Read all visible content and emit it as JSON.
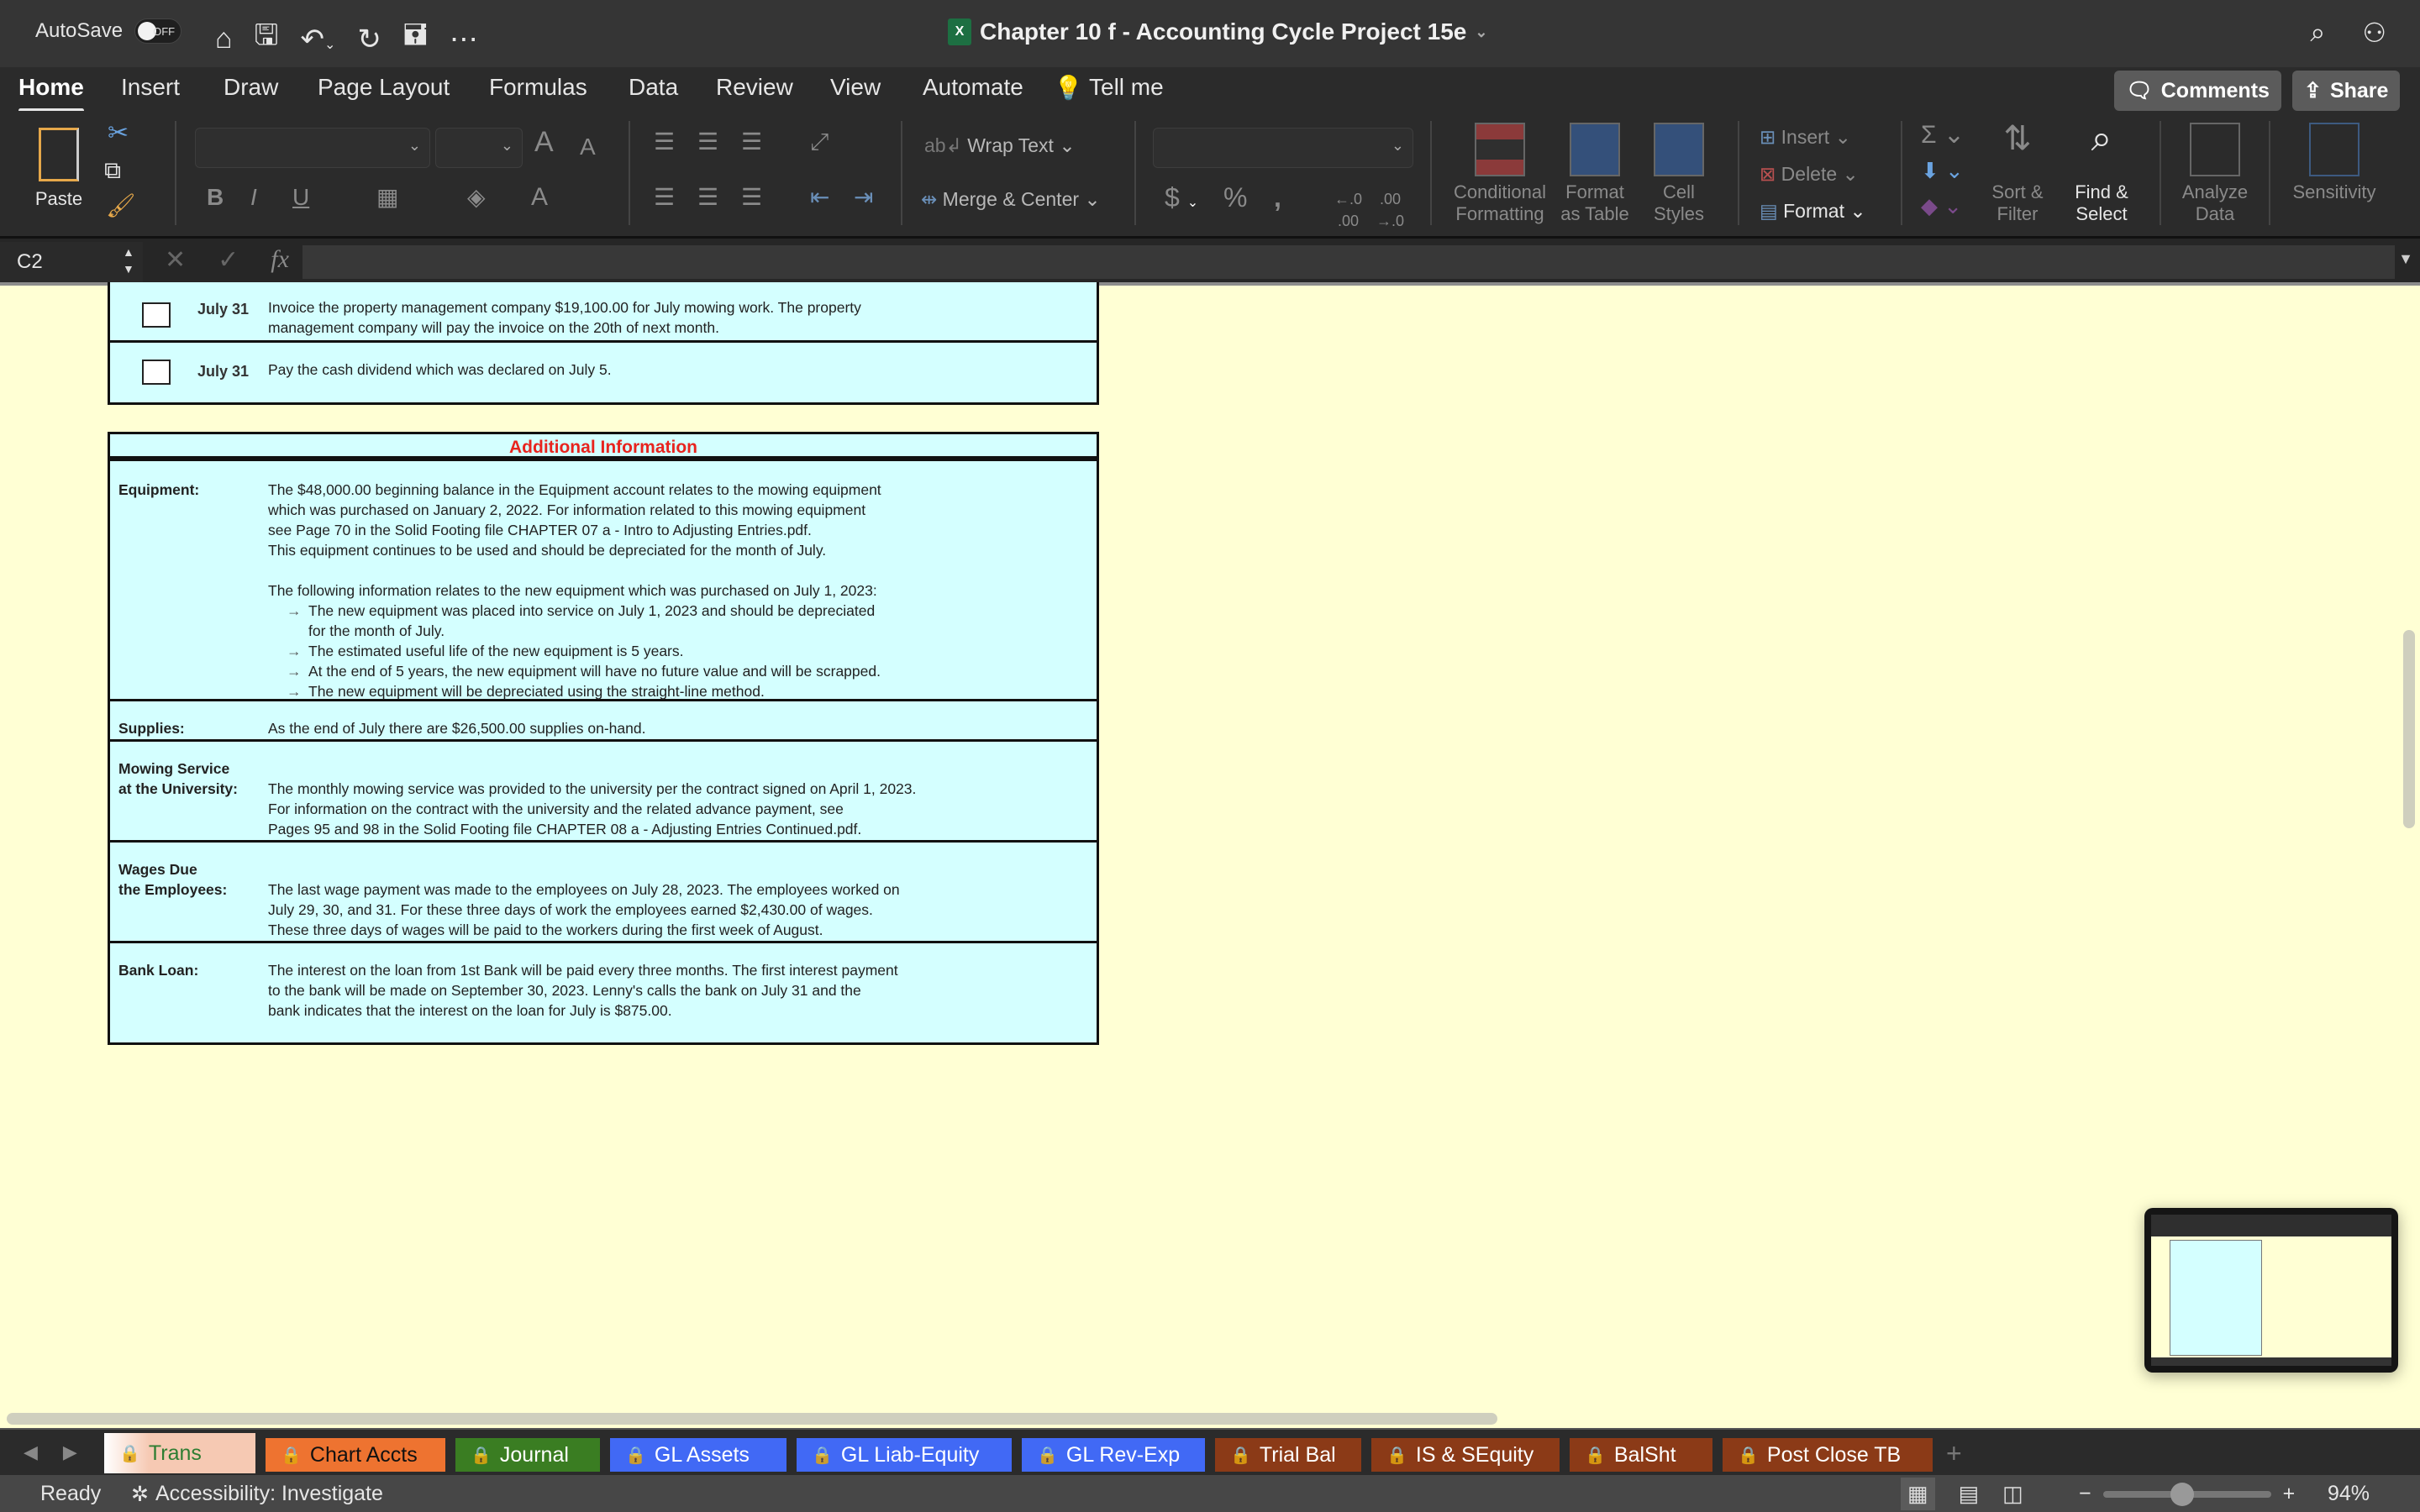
{
  "titlebar": {
    "autosave_label": "AutoSave",
    "autosave_state": "OFF",
    "document_title": "Chapter 10 f - Accounting Cycle Project 15e"
  },
  "ribbon_tabs": [
    "Home",
    "Insert",
    "Draw",
    "Page Layout",
    "Formulas",
    "Data",
    "Review",
    "View",
    "Automate",
    "Tell me"
  ],
  "ribbon_buttons": {
    "comments": "Comments",
    "share": "Share",
    "paste": "Paste",
    "wrap_text": "Wrap Text",
    "merge_center": "Merge & Center",
    "conditional_formatting": "Conditional\nFormatting",
    "format_as_table": "Format\nas Table",
    "cell_styles": "Cell\nStyles",
    "insert": "Insert",
    "delete": "Delete",
    "format": "Format",
    "sort_filter": "Sort &\nFilter",
    "find_select": "Find &\nSelect",
    "analyze_data": "Analyze\nData",
    "sensitivity": "Sensitivity"
  },
  "formula_bar": {
    "name_box": "C2",
    "formula": ""
  },
  "transactions": [
    {
      "date": "July 31",
      "lines": [
        "Invoice the property management company $19,100.00 for July mowing work.  The property",
        "management company will pay the invoice on the 20th of next month."
      ],
      "checked": false
    },
    {
      "date": "July 31",
      "lines": [
        "Pay the cash dividend which was declared on July 5."
      ],
      "checked": false
    }
  ],
  "additional_info": {
    "title": "Additional Information",
    "sections": [
      {
        "label": [
          "Equipment:"
        ],
        "lines": [
          "The $48,000.00 beginning balance in the Equipment account relates to the mowing equipment",
          "which was purchased on January 2, 2022.  For information related to this mowing equipment",
          "see Page 70 in the Solid Footing file CHAPTER 07 a - Intro to Adjusting Entries.pdf.",
          "This equipment continues to be used and should be depreciated for the month of July.",
          "",
          "The following information relates to the new equipment which was purchased on July 1, 2023:"
        ],
        "bullets": [
          [
            "The new equipment was placed into service on July 1, 2023 and should be depreciated",
            "for the month of July."
          ],
          [
            "The estimated useful life of the new equipment is 5 years."
          ],
          [
            "At the end of 5 years, the new equipment will have no future value and will be scrapped."
          ],
          [
            "The new equipment will be depreciated using the straight-line method."
          ]
        ]
      },
      {
        "label": [
          "Supplies:"
        ],
        "lines": [
          "As the end of July there are $26,500.00 supplies on-hand."
        ]
      },
      {
        "label": [
          "Mowing Service",
          "at the University:"
        ],
        "lines": [
          "The monthly mowing service was provided to the university per the contract signed on April 1, 2023.",
          "For information on the contract with the university and the related advance payment, see",
          "Pages 95 and 98 in the Solid Footing file CHAPTER 08 a - Adjusting Entries Continued.pdf."
        ]
      },
      {
        "label": [
          "Wages Due",
          "the Employees:"
        ],
        "lines": [
          "The last wage payment was made to the employees on July 28, 2023.  The employees worked on",
          "July 29, 30, and 31.  For these three days of work the employees earned $2,430.00 of wages.",
          "These three days of wages will be paid to the workers during the first week of August."
        ]
      },
      {
        "label": [
          "Bank Loan:"
        ],
        "lines": [
          "The interest on the loan from 1st Bank will be paid every three months.  The first interest payment",
          "to the bank will be made on September 30, 2023.  Lenny's calls the bank on July 31 and the",
          "bank indicates that the interest on the loan for July is $875.00."
        ]
      }
    ]
  },
  "sheet_tabs": [
    {
      "label": "Trans",
      "color": "#f6c9b3",
      "text_color": "#2e7d32",
      "active": true
    },
    {
      "label": "Chart Accts",
      "color": "#ee7330",
      "text_color": "#111111",
      "active": false
    },
    {
      "label": "Journal",
      "color": "#3a7d22",
      "text_color": "#ffffff",
      "active": false
    },
    {
      "label": "GL Assets",
      "color": "#4169f5",
      "text_color": "#ffffff",
      "active": false
    },
    {
      "label": "GL Liab-Equity",
      "color": "#4169f5",
      "text_color": "#ffffff",
      "active": false
    },
    {
      "label": "GL Rev-Exp",
      "color": "#4169f5",
      "text_color": "#ffffff",
      "active": false
    },
    {
      "label": "Trial Bal",
      "color": "#8b3a17",
      "text_color": "#ffffff",
      "active": false
    },
    {
      "label": "IS & SEquity",
      "color": "#8b3a17",
      "text_color": "#ffffff",
      "active": false
    },
    {
      "label": "BalSht",
      "color": "#8b3a17",
      "text_color": "#ffffff",
      "active": false
    },
    {
      "label": "Post Close TB",
      "color": "#8b3a17",
      "text_color": "#ffffff",
      "active": false
    }
  ],
  "status_bar": {
    "ready": "Ready",
    "accessibility": "Accessibility: Investigate",
    "zoom": "94%",
    "zoom_level": 0.47
  }
}
